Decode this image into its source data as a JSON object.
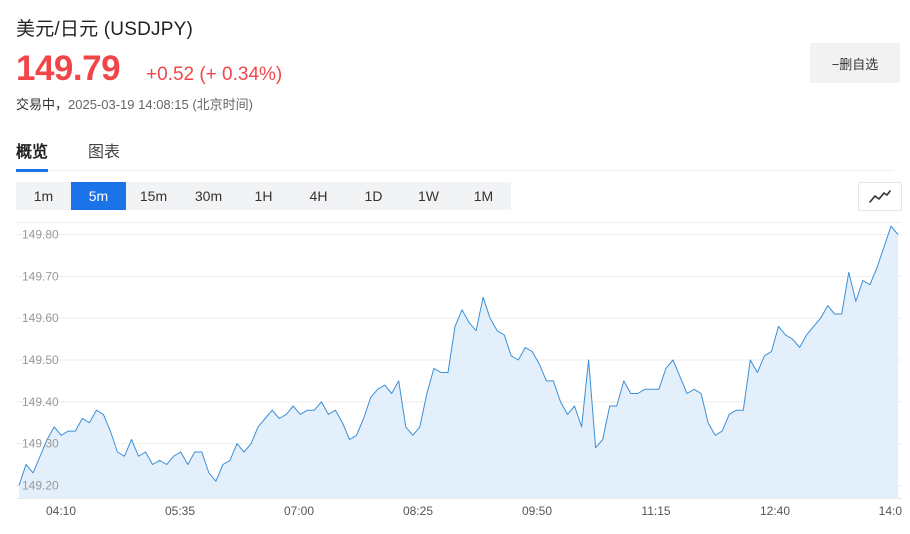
{
  "header": {
    "title": "美元/日元  (USDJPY)",
    "price": "149.79",
    "change": "+0.52 (+ 0.34%)",
    "status_label": "交易中，",
    "timestamp": "2025-03-19 14:08:15 (北京时间)",
    "favorite_button_label": "−删自选"
  },
  "tabs": [
    {
      "label": "概览",
      "active": true
    },
    {
      "label": "图表",
      "active": false
    }
  ],
  "intervals": [
    {
      "label": "1m",
      "active": false
    },
    {
      "label": "5m",
      "active": true
    },
    {
      "label": "15m",
      "active": false
    },
    {
      "label": "30m",
      "active": false
    },
    {
      "label": "1H",
      "active": false
    },
    {
      "label": "4H",
      "active": false
    },
    {
      "label": "1D",
      "active": false
    },
    {
      "label": "1W",
      "active": false
    },
    {
      "label": "1M",
      "active": false
    }
  ],
  "chart_type_icon": "line-chart-icon",
  "colors": {
    "accent": "#1a73e8",
    "price_up": "#f0464a",
    "line": "#3d8fd6",
    "area": "#e3f0fc"
  },
  "chart_data": {
    "type": "area",
    "title": "",
    "xlabel": "",
    "ylabel": "",
    "ylim": [
      149.17,
      149.83
    ],
    "y_ticks": [
      "149.80",
      "149.70",
      "149.60",
      "149.50",
      "149.40",
      "149.30",
      "149.20"
    ],
    "x_ticks": [
      "04:10",
      "05:35",
      "07:00",
      "08:25",
      "09:50",
      "11:15",
      "12:40",
      "14:0"
    ],
    "grid": true,
    "series": [
      {
        "values": [
          149.2,
          149.25,
          149.23,
          149.27,
          149.31,
          149.34,
          149.32,
          149.33,
          149.33,
          149.36,
          149.35,
          149.38,
          149.37,
          149.33,
          149.28,
          149.27,
          149.31,
          149.27,
          149.28,
          149.25,
          149.26,
          149.25,
          149.27,
          149.28,
          149.25,
          149.28,
          149.28,
          149.23,
          149.21,
          149.25,
          149.26,
          149.3,
          149.28,
          149.3,
          149.34,
          149.36,
          149.38,
          149.36,
          149.37,
          149.39,
          149.37,
          149.38,
          149.38,
          149.4,
          149.37,
          149.38,
          149.35,
          149.31,
          149.32,
          149.36,
          149.41,
          149.43,
          149.44,
          149.42,
          149.45,
          149.34,
          149.32,
          149.34,
          149.42,
          149.48,
          149.47,
          149.47,
          149.58,
          149.62,
          149.59,
          149.57,
          149.65,
          149.6,
          149.57,
          149.56,
          149.51,
          149.5,
          149.53,
          149.52,
          149.49,
          149.45,
          149.45,
          149.4,
          149.37,
          149.39,
          149.34,
          149.5,
          149.29,
          149.31,
          149.39,
          149.39,
          149.45,
          149.42,
          149.42,
          149.43,
          149.43,
          149.43,
          149.48,
          149.5,
          149.46,
          149.42,
          149.43,
          149.42,
          149.35,
          149.32,
          149.33,
          149.37,
          149.38,
          149.38,
          149.5,
          149.47,
          149.51,
          149.52,
          149.58,
          149.56,
          149.55,
          149.53,
          149.56,
          149.58,
          149.6,
          149.63,
          149.61,
          149.61,
          149.71,
          149.64,
          149.69,
          149.68,
          149.72,
          149.77,
          149.82,
          149.8
        ]
      }
    ]
  }
}
